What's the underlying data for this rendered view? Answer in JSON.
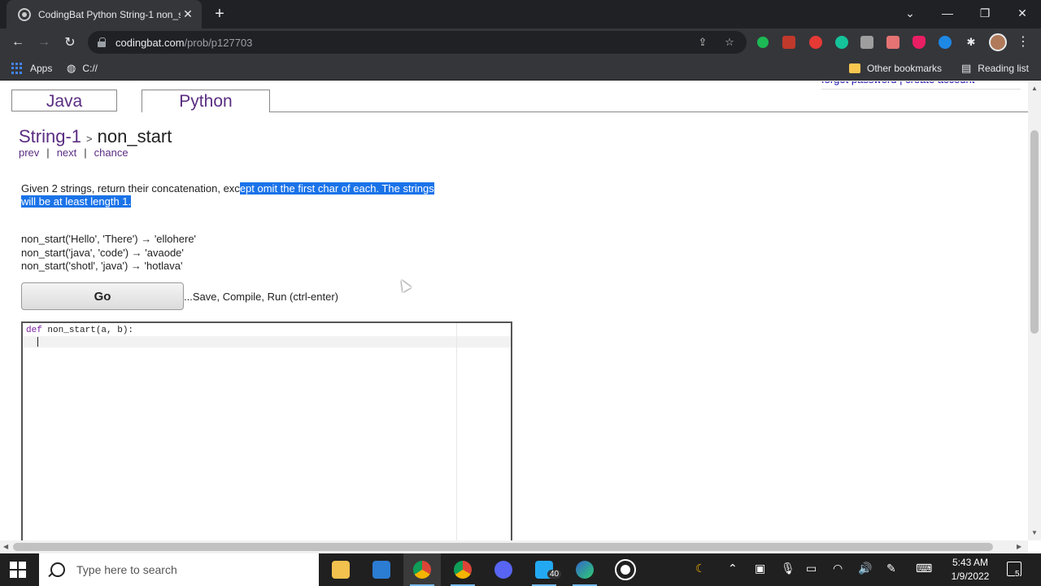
{
  "browser": {
    "tab_title": "CodingBat Python String-1 non_s",
    "tab_close": "✕",
    "new_tab": "+",
    "url_host": "codingbat.com",
    "url_path": "/prob/p127703",
    "window_controls": {
      "dropdown": "⌄",
      "minimize": "—",
      "restore": "❐",
      "close": "✕"
    },
    "bookmarks": {
      "apps": "Apps",
      "c_drive": "C://",
      "other": "Other bookmarks",
      "reading_list": "Reading list"
    }
  },
  "page": {
    "account_links": "forgot password | create account",
    "tabs": {
      "java": "Java",
      "python": "Python"
    },
    "breadcrumb": {
      "category": "String-1",
      "separator": ">",
      "problem": "non_start"
    },
    "nav": {
      "prev": "prev",
      "next": "next",
      "chance": "chance",
      "separator": "|"
    },
    "description": {
      "plain": "Given 2 strings, return their concatenation, exc",
      "highlighted_1": "ept omit the first char of each. The strings",
      "highlighted_2": "will be at least length 1."
    },
    "examples": [
      "non_start('Hello', 'There') → 'ellohere'",
      "non_start('java', 'code') → 'avaode'",
      "non_start('shotl', 'java') → 'hotlava'"
    ],
    "go_button": "Go",
    "go_hint": "...Save, Compile, Run (ctrl-enter)",
    "editor": {
      "keyword": "def",
      "signature": " non_start(a, b):"
    }
  },
  "taskbar": {
    "search_placeholder": "Type here to search",
    "badge_count": "40",
    "time": "5:43 AM",
    "date": "1/9/2022",
    "notification_count": "5"
  },
  "colors": {
    "selection": "#1a73e8",
    "link_purple": "#5a2d82",
    "chrome_dark": "#35363a"
  }
}
